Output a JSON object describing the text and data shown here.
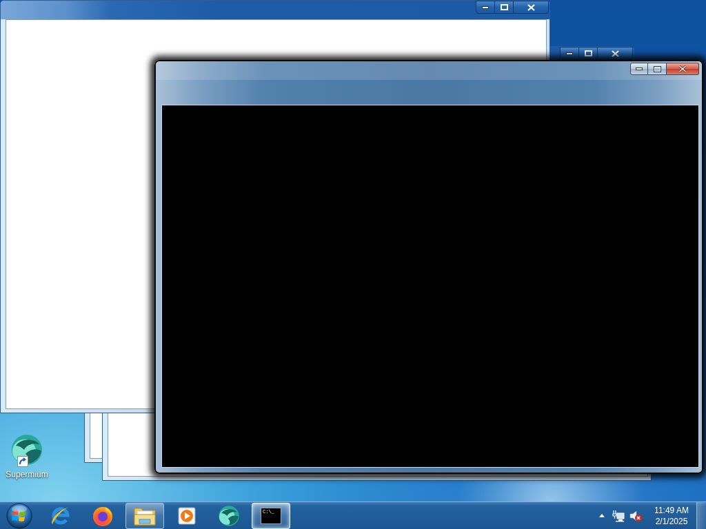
{
  "windows": [
    {
      "kind": "blank",
      "active": false
    },
    {
      "kind": "blank",
      "active": false
    },
    {
      "kind": "blank",
      "active": false
    },
    {
      "kind": "console",
      "active": true
    }
  ],
  "desktop_icons": [
    {
      "label": "Supermium",
      "shortcut": true
    }
  ],
  "taskbar": {
    "items": [
      {
        "kind": "ie",
        "running": false,
        "selected": false
      },
      {
        "kind": "firefox",
        "running": false,
        "selected": false
      },
      {
        "kind": "explorer",
        "running": true,
        "selected": false
      },
      {
        "kind": "media",
        "running": false,
        "selected": false
      },
      {
        "kind": "supermium",
        "running": false,
        "selected": false
      },
      {
        "kind": "console",
        "running": true,
        "selected": true,
        "glyph": "C:\\_"
      }
    ],
    "tray": {
      "volume_muted": true,
      "time": "11:49 AM",
      "date": "2/1/2025"
    }
  }
}
